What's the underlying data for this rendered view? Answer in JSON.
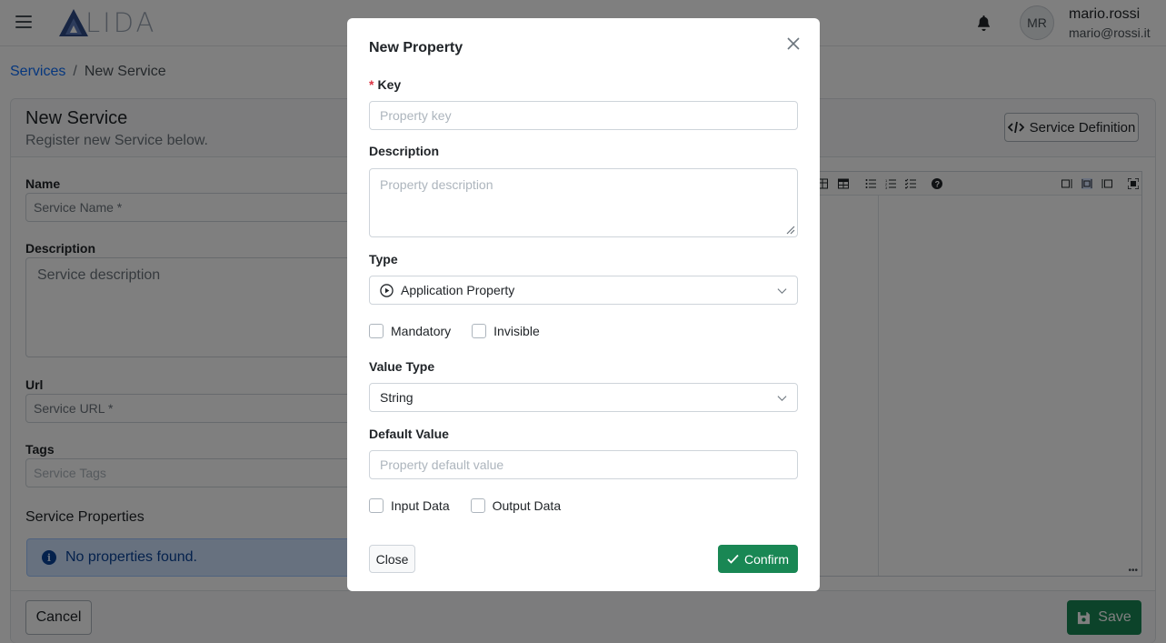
{
  "navbar": {
    "logo_text": "LIDA",
    "avatar_initials": "MR",
    "user_name": "mario.rossi",
    "user_email": "mario@rossi.it"
  },
  "breadcrumb": {
    "parent": "Services",
    "separator": "/",
    "current": "New Service"
  },
  "page": {
    "title": "New Service",
    "subtitle": "Register new Service below.",
    "service_definition_label": "Service Definition",
    "fields": {
      "name_label": "Name",
      "name_placeholder": "Service Name *",
      "description_label": "Description",
      "description_placeholder": "Service description",
      "url_label": "Url",
      "url_placeholder": "Service URL *",
      "tags_label": "Tags",
      "tags_placeholder": "Service Tags"
    },
    "properties_title": "Service Properties",
    "no_properties": "No properties found.",
    "cancel_label": "Cancel",
    "save_label": "Save"
  },
  "modal": {
    "title": "New Property",
    "key_required_mark": "*",
    "key_label": "Key",
    "key_placeholder": "Property key",
    "description_label": "Description",
    "description_placeholder": "Property description",
    "type_label": "Type",
    "type_value": "Application Property",
    "mandatory_label": "Mandatory",
    "invisible_label": "Invisible",
    "value_type_label": "Value Type",
    "value_type_value": "String",
    "default_value_label": "Default Value",
    "default_value_placeholder": "Property default value",
    "input_data_label": "Input Data",
    "output_data_label": "Output Data",
    "close_label": "Close",
    "confirm_label": "Confirm",
    "checkboxes": {
      "mandatory": false,
      "invisible": false,
      "input_data": false,
      "output_data": false
    }
  },
  "colors": {
    "primary": "#0d6efd",
    "success": "#198754",
    "danger": "#dc3545",
    "info_bg": "#cfe2ff"
  }
}
